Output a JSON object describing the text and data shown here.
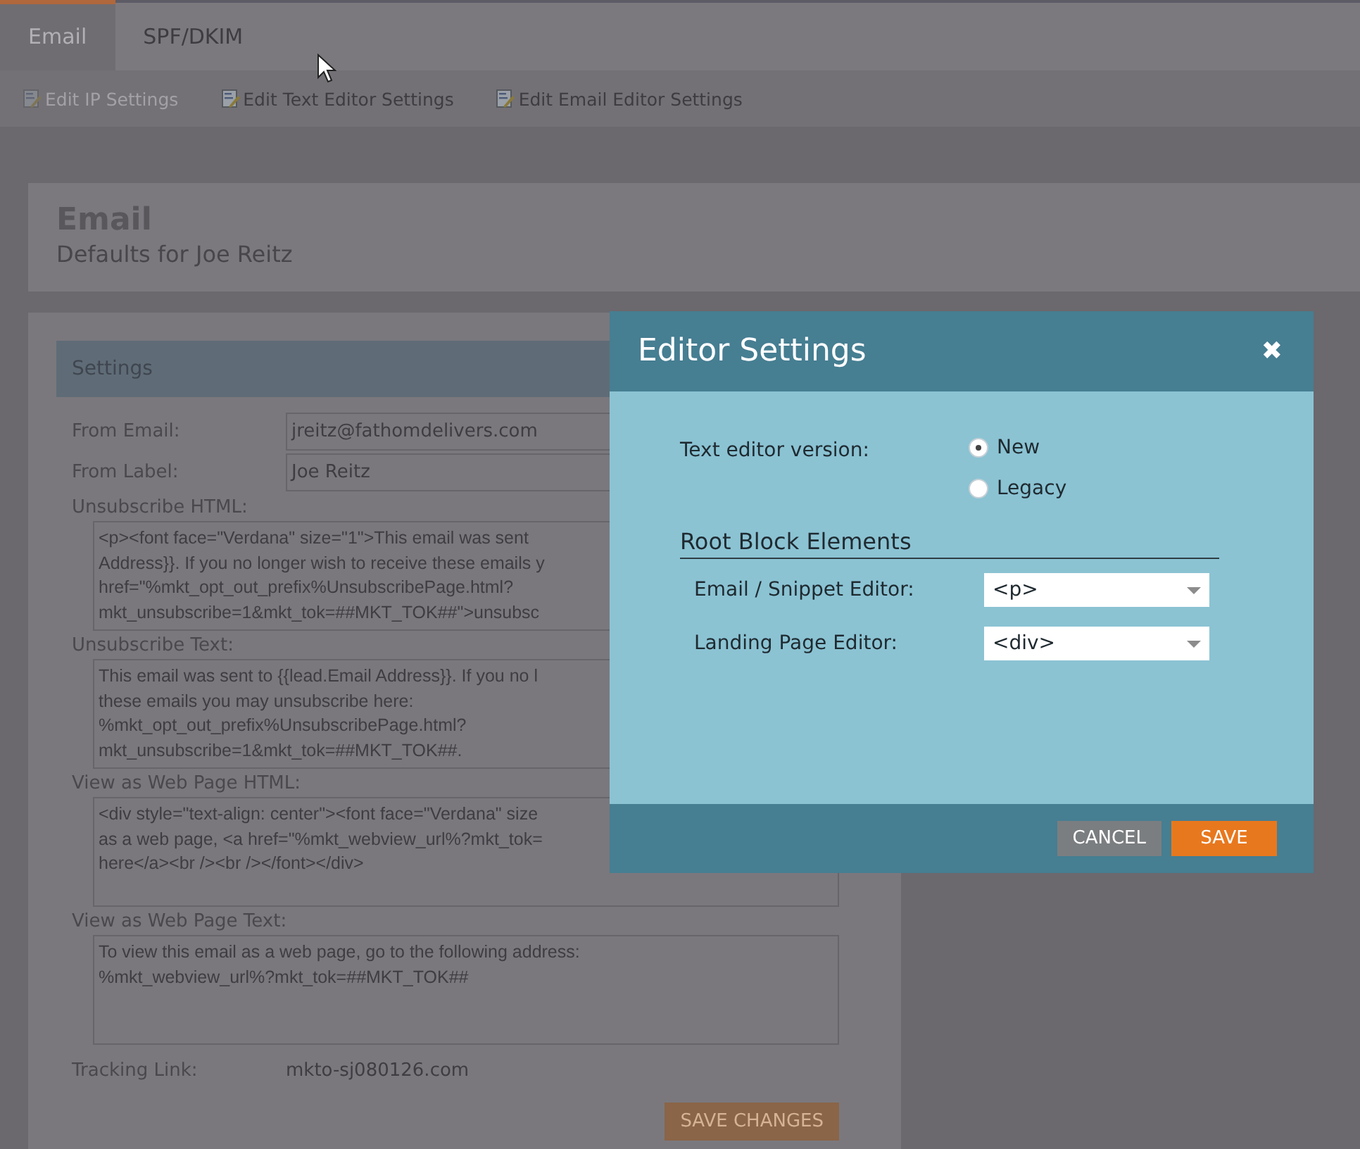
{
  "tabs": [
    {
      "label": "Email",
      "selected": true
    },
    {
      "label": "SPF/DKIM",
      "selected": false
    }
  ],
  "toolbar": [
    {
      "label": "Edit IP Settings",
      "disabled": true
    },
    {
      "label": "Edit Text Editor Settings",
      "disabled": false
    },
    {
      "label": "Edit Email Editor Settings",
      "disabled": false
    }
  ],
  "header": {
    "title": "Email",
    "subtitle": "Defaults for Joe Reitz"
  },
  "settings": {
    "title": "Settings",
    "fields": [
      {
        "label": "From Email:",
        "value": "jreitz@fathomdelivers.com"
      },
      {
        "label": "From Label:",
        "value": "Joe Reitz"
      }
    ],
    "text_areas": [
      {
        "label": "Unsubscribe HTML:",
        "lines": [
          "<p><font face=\"Verdana\" size=\"1\">This email was sent",
          "Address}}. If you no longer wish to receive these emails y",
          "href=\"%mkt_opt_out_prefix%UnsubscribePage.html?",
          "mkt_unsubscribe=1&mkt_tok=##MKT_TOK##\">unsubsc"
        ]
      },
      {
        "label": "Unsubscribe Text:",
        "lines": [
          "This email was sent to {{lead.Email Address}}. If you no l",
          "these emails you may unsubscribe here:",
          "%mkt_opt_out_prefix%UnsubscribePage.html?",
          "mkt_unsubscribe=1&mkt_tok=##MKT_TOK##."
        ]
      },
      {
        "label": "View as Web Page HTML:",
        "lines": [
          "<div style=\"text-align: center\"><font face=\"Verdana\" size",
          "as a web page, <a href=\"%mkt_webview_url%?mkt_tok=",
          "here</a><br /><br /></font></div>"
        ]
      },
      {
        "label": "View as Web Page Text:",
        "lines": [
          "To view this email as a web page, go to the following address:",
          "%mkt_webview_url%?mkt_tok=##MKT_TOK##"
        ]
      }
    ],
    "tracking": {
      "label": "Tracking Link:",
      "value": "mkto-sj080126.com"
    },
    "save_button": "SAVE CHANGES"
  },
  "dialog": {
    "title": "Editor Settings",
    "close": "✖",
    "version_label": "Text editor version:",
    "versions": [
      {
        "label": "New",
        "selected": true
      },
      {
        "label": "Legacy",
        "selected": false
      }
    ],
    "section_title": "Root Block Elements",
    "selects": [
      {
        "label": "Email / Snippet Editor:",
        "value": "<p>"
      },
      {
        "label": "Landing Page Editor:",
        "value": "<div>"
      }
    ],
    "cancel": "CANCEL",
    "save": "SAVE"
  }
}
